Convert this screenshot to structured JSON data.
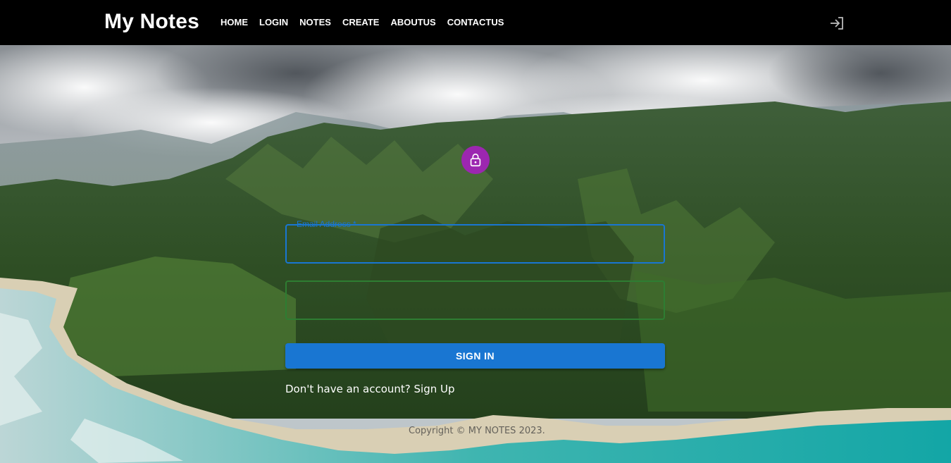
{
  "navbar": {
    "brand": "My Notes",
    "links": [
      "HOME",
      "LOGIN",
      "NOTES",
      "CREATE",
      "ABOUTUS",
      "CONTACTUS"
    ]
  },
  "form": {
    "email_label": "Email Address *",
    "email_value": "",
    "password_value": "",
    "signin_label": "SIGN IN",
    "signup_text": "Don't have an account? Sign Up"
  },
  "footer": {
    "copyright": "Copyright © MY NOTES 2023."
  },
  "colors": {
    "navbar_bg": "#000000",
    "primary": "#1976d2",
    "avatar": "#9c27b0",
    "password_border": "#2e7d32"
  },
  "icons": {
    "login": "login-arrow-icon",
    "lock": "lock-icon"
  }
}
